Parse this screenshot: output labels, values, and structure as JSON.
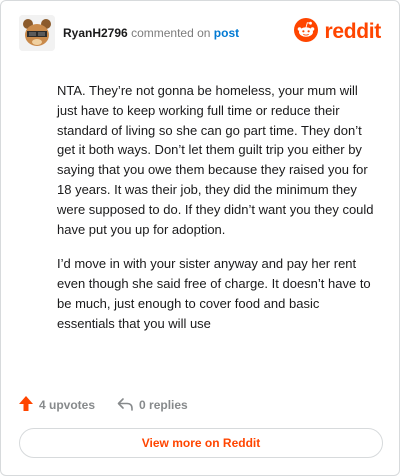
{
  "header": {
    "username": "RyanH2796",
    "action_text": "commented on",
    "post_link": "post",
    "brand": "reddit"
  },
  "comment": {
    "paragraphs": [
      "NTA. They’re not gonna be homeless, your mum will just have to keep working full time or reduce their standard of living so she can go part time. They don’t get it both ways. Don’t let them guilt trip you either by saying that you owe them because they raised you for 18 years. It was their job, they did the minimum they were supposed to do. If they didn’t want you they could have put you up for adoption.",
      "I’d move in with your sister anyway and pay her rent even though she said free of charge. It doesn’t have to be much, just enough to cover food and basic essentials that you will use"
    ]
  },
  "stats": {
    "upvotes": "4 upvotes",
    "replies": "0 replies"
  },
  "footer": {
    "view_more": "View more on Reddit"
  },
  "colors": {
    "accent": "#ff4500",
    "link": "#0079d3",
    "muted": "#878a8c"
  },
  "icons": {
    "avatar": "avatar-icon",
    "logo": "reddit-logo-icon",
    "upvote": "upvote-arrow-icon",
    "reply": "reply-arrow-icon"
  }
}
